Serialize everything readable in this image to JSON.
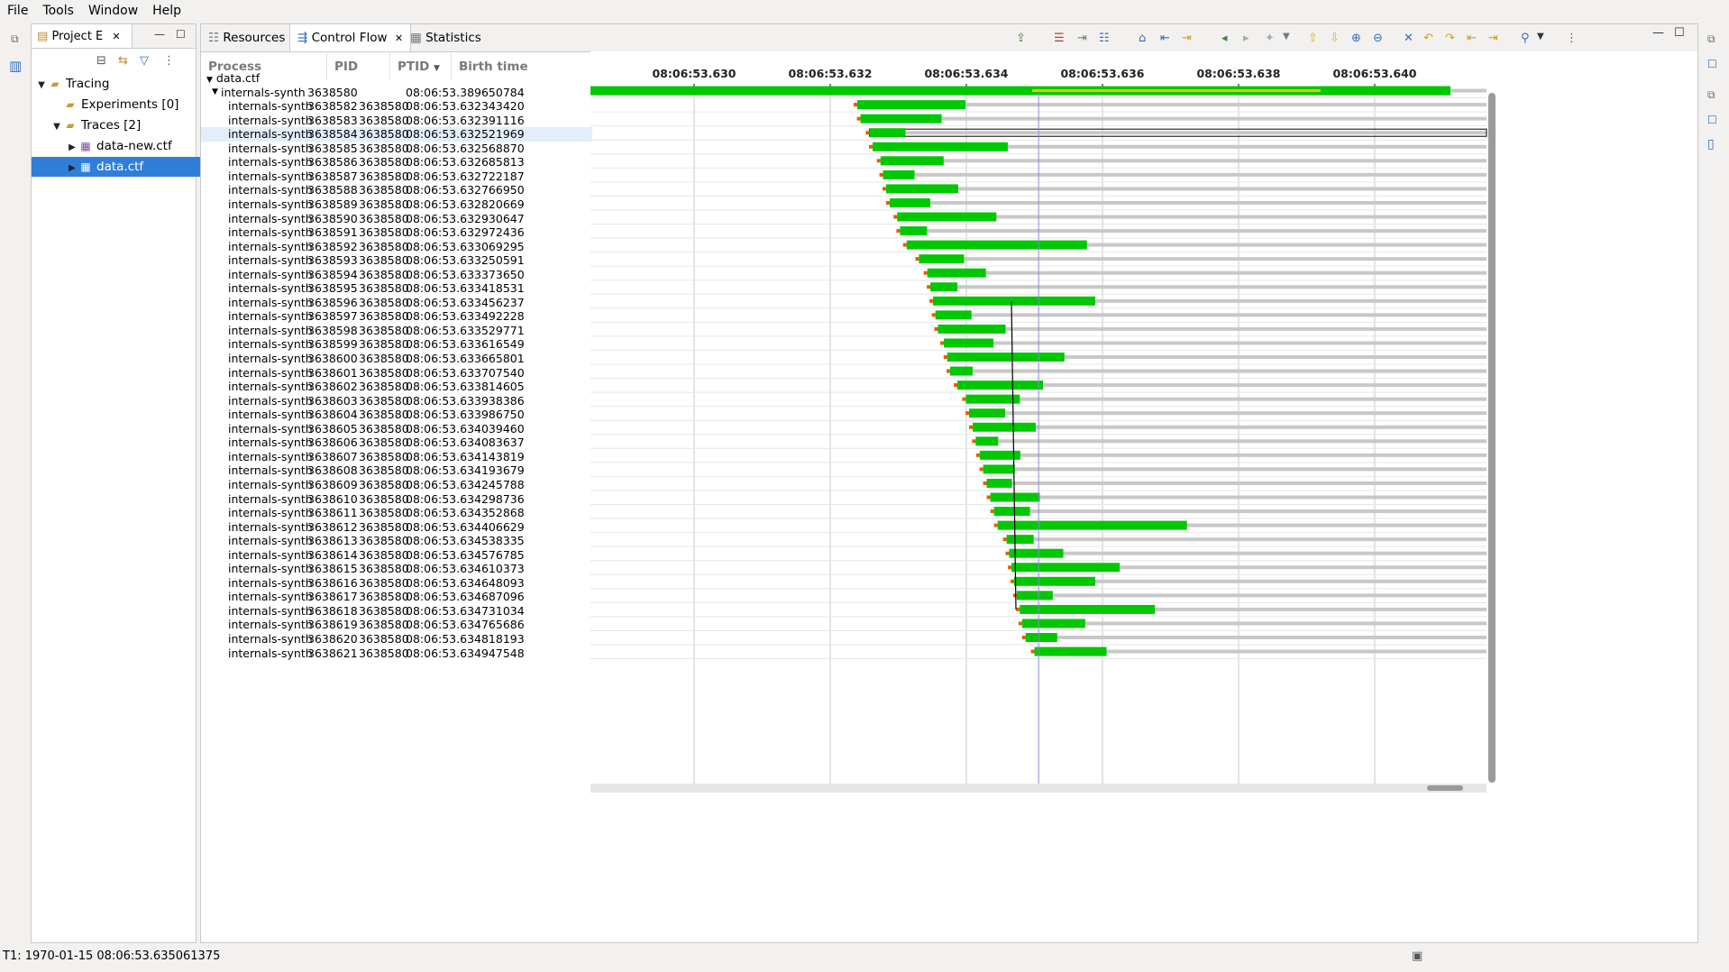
{
  "menu": [
    "File",
    "Tools",
    "Window",
    "Help"
  ],
  "project_view": {
    "tab_label": "Project E",
    "tree": [
      {
        "label": "Tracing",
        "level": 0,
        "twisty": "open",
        "icon": "folder-icon"
      },
      {
        "label": "Experiments [0]",
        "level": 1,
        "twisty": "none",
        "icon": "folder-icon"
      },
      {
        "label": "Traces [2]",
        "level": 1,
        "twisty": "open",
        "icon": "folder-icon"
      },
      {
        "label": "data-new.ctf",
        "level": 2,
        "twisty": "closed",
        "icon": "trace-icon"
      },
      {
        "label": "data.ctf",
        "level": 2,
        "twisty": "closed",
        "icon": "trace-icon",
        "selected": true
      }
    ]
  },
  "main_view": {
    "tabs": [
      {
        "label": "Resources",
        "active": false
      },
      {
        "label": "Control Flow",
        "active": true
      },
      {
        "label": "Statistics",
        "active": false
      }
    ],
    "columns": [
      "Process",
      "PID",
      "PTID",
      "Birth time"
    ],
    "time_ticks": [
      "08:06:53.630",
      "08:06:53.632",
      "08:06:53.634",
      "08:06:53.636",
      "08:06:53.638",
      "08:06:53.640"
    ],
    "root": "data.ctf",
    "rows": [
      {
        "process": "internals-synth",
        "pid": "3638580",
        "ptid": "",
        "birth": "08:06:53.389650784",
        "parent": true
      },
      {
        "process": "internals-synth",
        "pid": "3638582",
        "ptid": "3638580",
        "birth": "08:06:53.632343420"
      },
      {
        "process": "internals-synth",
        "pid": "3638583",
        "ptid": "3638580",
        "birth": "08:06:53.632391116"
      },
      {
        "process": "internals-synth",
        "pid": "3638584",
        "ptid": "3638580",
        "birth": "08:06:53.632521969"
      },
      {
        "process": "internals-synth",
        "pid": "3638585",
        "ptid": "3638580",
        "birth": "08:06:53.632568870"
      },
      {
        "process": "internals-synth",
        "pid": "3638586",
        "ptid": "3638580",
        "birth": "08:06:53.632685813"
      },
      {
        "process": "internals-synth",
        "pid": "3638587",
        "ptid": "3638580",
        "birth": "08:06:53.632722187"
      },
      {
        "process": "internals-synth",
        "pid": "3638588",
        "ptid": "3638580",
        "birth": "08:06:53.632766950"
      },
      {
        "process": "internals-synth",
        "pid": "3638589",
        "ptid": "3638580",
        "birth": "08:06:53.632820669"
      },
      {
        "process": "internals-synth",
        "pid": "3638590",
        "ptid": "3638580",
        "birth": "08:06:53.632930647"
      },
      {
        "process": "internals-synth",
        "pid": "3638591",
        "ptid": "3638580",
        "birth": "08:06:53.632972436"
      },
      {
        "process": "internals-synth",
        "pid": "3638592",
        "ptid": "3638580",
        "birth": "08:06:53.633069295"
      },
      {
        "process": "internals-synth",
        "pid": "3638593",
        "ptid": "3638580",
        "birth": "08:06:53.633250591"
      },
      {
        "process": "internals-synth",
        "pid": "3638594",
        "ptid": "3638580",
        "birth": "08:06:53.633373650"
      },
      {
        "process": "internals-synth",
        "pid": "3638595",
        "ptid": "3638580",
        "birth": "08:06:53.633418531"
      },
      {
        "process": "internals-synth",
        "pid": "3638596",
        "ptid": "3638580",
        "birth": "08:06:53.633456237"
      },
      {
        "process": "internals-synth",
        "pid": "3638597",
        "ptid": "3638580",
        "birth": "08:06:53.633492228"
      },
      {
        "process": "internals-synth",
        "pid": "3638598",
        "ptid": "3638580",
        "birth": "08:06:53.633529771"
      },
      {
        "process": "internals-synth",
        "pid": "3638599",
        "ptid": "3638580",
        "birth": "08:06:53.633616549"
      },
      {
        "process": "internals-synth",
        "pid": "3638600",
        "ptid": "3638580",
        "birth": "08:06:53.633665801"
      },
      {
        "process": "internals-synth",
        "pid": "3638601",
        "ptid": "3638580",
        "birth": "08:06:53.633707540"
      },
      {
        "process": "internals-synth",
        "pid": "3638602",
        "ptid": "3638580",
        "birth": "08:06:53.633814605"
      },
      {
        "process": "internals-synth",
        "pid": "3638603",
        "ptid": "3638580",
        "birth": "08:06:53.633938386"
      },
      {
        "process": "internals-synth",
        "pid": "3638604",
        "ptid": "3638580",
        "birth": "08:06:53.633986750"
      },
      {
        "process": "internals-synth",
        "pid": "3638605",
        "ptid": "3638580",
        "birth": "08:06:53.634039460"
      },
      {
        "process": "internals-synth",
        "pid": "3638606",
        "ptid": "3638580",
        "birth": "08:06:53.634083637"
      },
      {
        "process": "internals-synth",
        "pid": "3638607",
        "ptid": "3638580",
        "birth": "08:06:53.634143819"
      },
      {
        "process": "internals-synth",
        "pid": "3638608",
        "ptid": "3638580",
        "birth": "08:06:53.634193679"
      },
      {
        "process": "internals-synth",
        "pid": "3638609",
        "ptid": "3638580",
        "birth": "08:06:53.634245788"
      },
      {
        "process": "internals-synth",
        "pid": "3638610",
        "ptid": "3638580",
        "birth": "08:06:53.634298736"
      },
      {
        "process": "internals-synth",
        "pid": "3638611",
        "ptid": "3638580",
        "birth": "08:06:53.634352868"
      },
      {
        "process": "internals-synth",
        "pid": "3638612",
        "ptid": "3638580",
        "birth": "08:06:53.634406629"
      },
      {
        "process": "internals-synth",
        "pid": "3638613",
        "ptid": "3638580",
        "birth": "08:06:53.634538335"
      },
      {
        "process": "internals-synth",
        "pid": "3638614",
        "ptid": "3638580",
        "birth": "08:06:53.634576785"
      },
      {
        "process": "internals-synth",
        "pid": "3638615",
        "ptid": "3638580",
        "birth": "08:06:53.634610373"
      },
      {
        "process": "internals-synth",
        "pid": "3638616",
        "ptid": "3638580",
        "birth": "08:06:53.634648093"
      },
      {
        "process": "internals-synth",
        "pid": "3638617",
        "ptid": "3638580",
        "birth": "08:06:53.634687096"
      },
      {
        "process": "internals-synth",
        "pid": "3638618",
        "ptid": "3638580",
        "birth": "08:06:53.634731034"
      },
      {
        "process": "internals-synth",
        "pid": "3638619",
        "ptid": "3638580",
        "birth": "08:06:53.634765686"
      },
      {
        "process": "internals-synth",
        "pid": "3638620",
        "ptid": "3638580",
        "birth": "08:06:53.634818193"
      },
      {
        "process": "internals-synth",
        "pid": "3638621",
        "ptid": "3638580",
        "birth": "08:06:53.634947548"
      }
    ],
    "selected_pid": "3638584"
  },
  "status_bar": "T1: 1970-01-15 08:06:53.635061375",
  "colors": {
    "running": "#00c800",
    "waiting": "#c8c8c8",
    "selection": "#2f7fd8",
    "cursor": "#8a8ad8",
    "yellow": "#e0c800"
  }
}
